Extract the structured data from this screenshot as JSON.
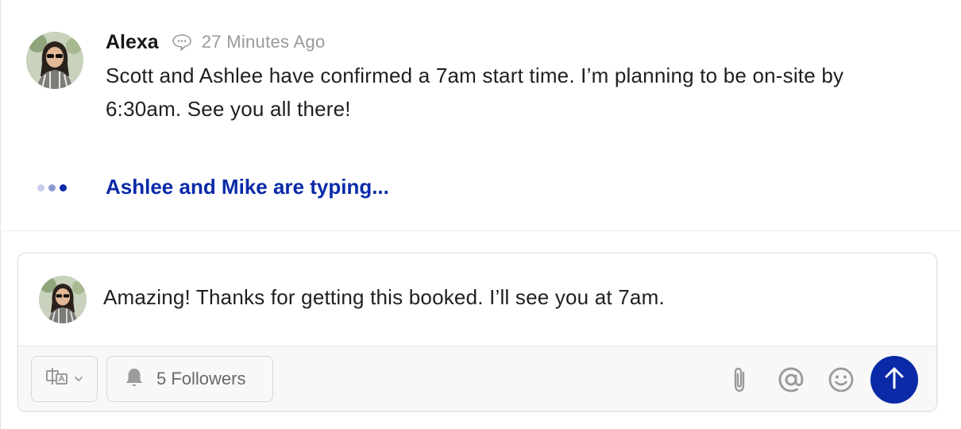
{
  "message": {
    "author": "Alexa",
    "timestamp": "27 Minutes Ago",
    "body": "Scott and Ashlee have confirmed a 7am start time. I’m planning to be on-site by 6:30am. See you all there!"
  },
  "typing": {
    "text": "Ashlee and Mike are typing..."
  },
  "composer": {
    "text": "Amazing! Thanks for getting this booked. I’ll see you at 7am.",
    "followers_label": "5 Followers",
    "icons": {
      "translate": "translate-icon",
      "chevron": "chevron-down-icon",
      "bell": "bell-icon",
      "attach": "paperclip-icon",
      "mention": "at-sign-icon",
      "emoji": "smiley-icon",
      "send": "arrow-up-icon"
    }
  },
  "colors": {
    "accent": "#0a2aa8",
    "send_button": "#0a2aa8",
    "icon_gray": "#9b9b9b",
    "timestamp": "#9a9a9a",
    "typing_dots": [
      "#c9cdea",
      "#8f99d6",
      "#0a2aa8"
    ]
  }
}
